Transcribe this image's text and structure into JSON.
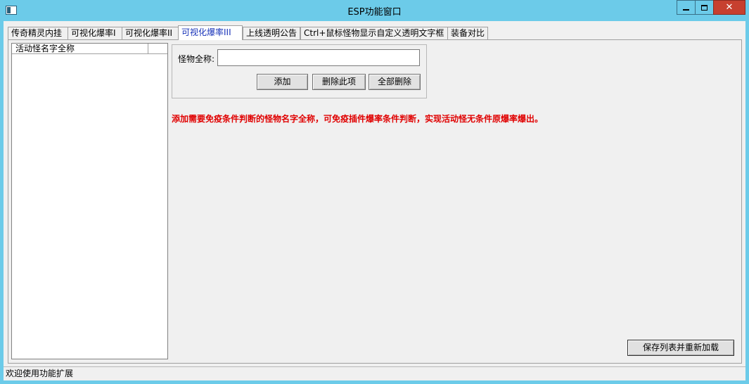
{
  "window": {
    "title": "ESP功能窗口",
    "close_glyph": "✕"
  },
  "tabs": [
    {
      "label": "传奇精灵内挂"
    },
    {
      "label": "可视化爆率I"
    },
    {
      "label": "可视化爆率II"
    },
    {
      "label": "可视化爆率III",
      "active": true
    },
    {
      "label": "上线透明公告"
    },
    {
      "label": "Ctrl+鼠标怪物显示自定义透明文字框"
    },
    {
      "label": "装备对比"
    }
  ],
  "list": {
    "column_header": "活动怪名字全称",
    "items": []
  },
  "form": {
    "name_label": "怪物全称:",
    "name_value": "",
    "add_label": "添加",
    "delete_label": "删除此项",
    "delete_all_label": "全部删除"
  },
  "notice_text": "添加需要免疫条件判断的怪物名字全称，可免疫插件爆率条件判断，实现活动怪无条件原爆率爆出。",
  "save_reload_label": "保存列表并重新加载",
  "status_text": "欢迎使用功能扩展",
  "colors": {
    "titlebar": "#6ccbe9",
    "active_tab_text": "#1530b8",
    "notice": "#e00000",
    "close_button": "#c7402f"
  }
}
